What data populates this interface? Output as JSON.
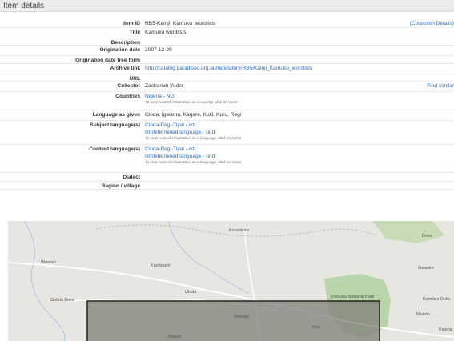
{
  "section": {
    "title": "Item details"
  },
  "fields": {
    "item_id": {
      "label": "Item ID",
      "value": "RB5-Kainji_Kamuku_wordlists",
      "link": "(Collection Details)"
    },
    "title": {
      "label": "Title",
      "value": "Kamuku wordlists"
    },
    "description": {
      "label": "Description",
      "value": ""
    },
    "origination_date": {
      "label": "Origination date",
      "value": "2007-12-29"
    },
    "origination_date_free_form": {
      "label": "Origination date free form",
      "value": ""
    },
    "archive_link": {
      "label": "Archive link",
      "value": "http://catalog.paradisec.org.au/repository/RB5/Kainji_Kamuku_wordlists"
    },
    "url": {
      "label": "URL",
      "value": ""
    },
    "collector": {
      "label": "Collector",
      "value": "Zachariah Yoder",
      "link": "Find similar"
    },
    "countries": {
      "label": "Countries",
      "value": "Nigeria - NG",
      "hint": "To view related information on a country, click its name"
    },
    "language_as_given": {
      "label": "Language as given",
      "value": "Cinda, Igwama, Kagare, Kuki, Kuru, Regi"
    },
    "subject_languages": {
      "label": "Subject language(s)",
      "items": [
        "Cinda-Regi-Tiyal - cdr",
        "Undetermined language - und"
      ],
      "hint": "To view related information on a language, click its name"
    },
    "content_languages": {
      "label": "Content language(s)",
      "items": [
        "Cinda-Regi-Tiyal - cdr",
        "Undetermined language - und"
      ],
      "hint": "To view related information on a language, click its name"
    },
    "dialect": {
      "label": "Dialect",
      "value": ""
    },
    "region_village": {
      "label": "Region / village",
      "value": ""
    }
  },
  "map": {
    "places": [
      "Kotonkoro",
      "Doko",
      "Wamari",
      "Kumbashi",
      "Gwasko",
      "Ukata",
      "Gulbin Boka",
      "Kamuku National Park",
      "Kamfani Doko",
      "Mando",
      "Wamba",
      "Kiru",
      "Kwona",
      "Makeri"
    ],
    "colors": {
      "land": "#e8e6e0",
      "park": "#b5d3a5",
      "selection_fill": "#7f7f78",
      "selection_border": "#222222",
      "road": "#ffffff",
      "river": "#a9c8e8"
    }
  }
}
